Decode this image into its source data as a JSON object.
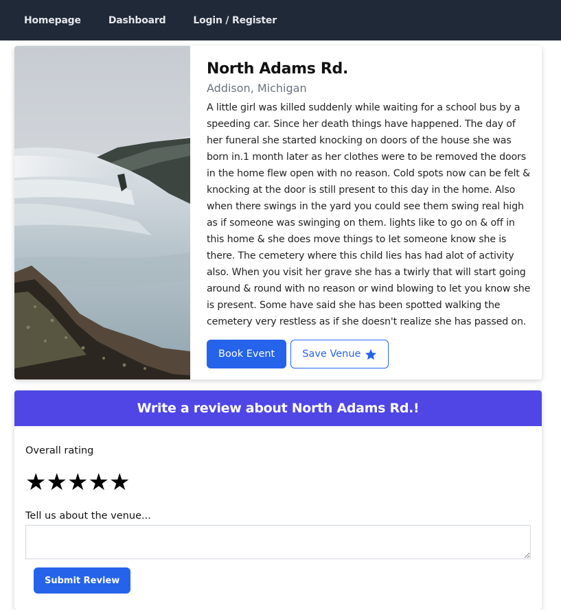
{
  "nav": {
    "items": [
      {
        "label": "Homepage"
      },
      {
        "label": "Dashboard"
      },
      {
        "label": "Login / Register"
      }
    ]
  },
  "venue": {
    "name": "North Adams Rd.",
    "location": "Addison, Michigan",
    "description": "A little girl was killed suddenly while waiting for a school bus by a speeding car. Since her death things have happened. The day of her funeral she started knocking on doors of the house she was born in.1 month later as her clothes were to be removed the doors in the home flew open with no reason. Cold spots now can be felt & knocking at the door is still present to this day in the home. Also when there swings in the yard you could see them swing real high as if someone was swinging on them. lights like to go on & off in this home & she does move things to let someone know she is there. The cemetery where this child lies has had alot of activity also. When you visit her grave she has a twirly that will start going around & round with no reason or wind blowing to let you know she is present. Some have said she has been spotted walking the cemetery very restless as if she doesn't realize she has passed on.",
    "book_label": "Book Event",
    "save_label": "Save Venue",
    "save_icon": "star-icon"
  },
  "review": {
    "header": "Write a review about North Adams Rd.!",
    "rating_label": "Overall rating",
    "stars": [
      "★",
      "★",
      "★",
      "★",
      "★"
    ],
    "text_label": "Tell us about the venue...",
    "text_value": "",
    "submit_label": "Submit Review"
  },
  "colors": {
    "navbar": "#1f2937",
    "primary": "#2563eb",
    "review_header": "#4f46e5"
  }
}
